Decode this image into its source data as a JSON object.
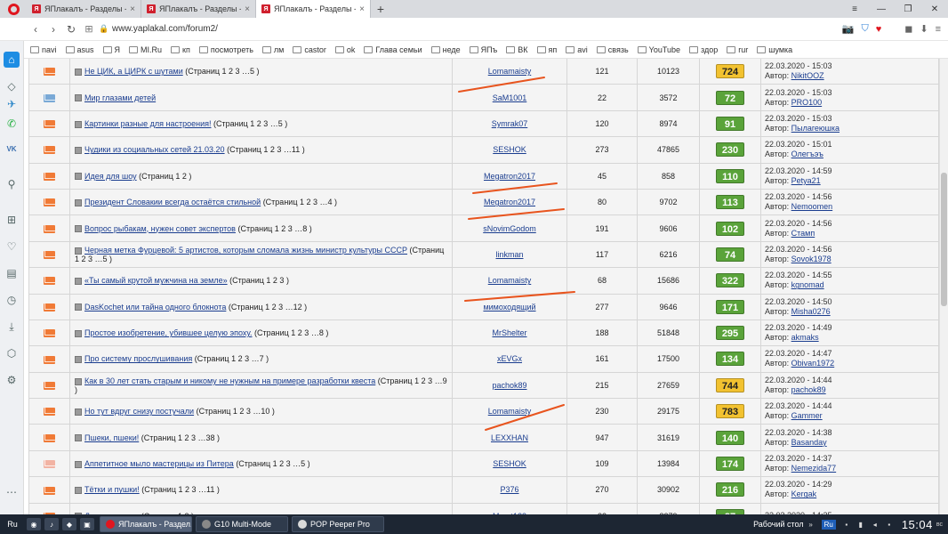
{
  "browser": {
    "tabs": [
      {
        "title": "ЯПлакалъ - Разделы -> Ка",
        "active": false
      },
      {
        "title": "ЯПлакалъ - Разделы -> Шу",
        "active": false
      },
      {
        "title": "ЯПлакалъ - Разделы -> Ка",
        "active": true
      }
    ],
    "new_tab": "+",
    "url": "www.yaplakal.com/forum2/"
  },
  "bookmarks": [
    "navi",
    "asus",
    "Я",
    "MI.Ru",
    "кп",
    "посмотреть",
    "лм",
    "castor",
    "ok",
    "Глава семьи",
    "неде",
    "ЯПъ",
    "ВК",
    "яп",
    "avi",
    "связь",
    "YouTube",
    "здор",
    "rur",
    "шумка"
  ],
  "topics": [
    {
      "icon": "orange",
      "title": "Не ЦИК, а ЦИРК с шутами",
      "pages": "(Страниц 1 2 3 …5 )",
      "author": "Lomamaisty",
      "replies": "121",
      "views": "10123",
      "rating": "724",
      "rating_color": "yellow",
      "last_date": "22.03.2020 - 15:03",
      "last_author": "NikitOOZ"
    },
    {
      "icon": "blue",
      "title": "Мир глазами детей",
      "pages": "",
      "author": "SaM1001",
      "replies": "22",
      "views": "3572",
      "rating": "72",
      "rating_color": "green",
      "last_date": "22.03.2020 - 15:03",
      "last_author": "PRO100"
    },
    {
      "icon": "orange",
      "title": "Картинки разные для настроения!",
      "pages": "(Страниц 1 2 3 …5 )",
      "author": "Symrak07",
      "replies": "120",
      "views": "8974",
      "rating": "91",
      "rating_color": "green",
      "last_date": "22.03.2020 - 15:03",
      "last_author": "Пылагеюшка"
    },
    {
      "icon": "orange",
      "title": "Чудики из социальных сетей 21.03.20",
      "pages": "(Страниц 1 2 3 …11 )",
      "author": "SESHOK",
      "replies": "273",
      "views": "47865",
      "rating": "230",
      "rating_color": "green",
      "last_date": "22.03.2020 - 15:01",
      "last_author": "Олегъэъ"
    },
    {
      "icon": "orange",
      "title": "Идея для шоу",
      "pages": "(Страниц 1 2 )",
      "author": "Megatron2017",
      "replies": "45",
      "views": "858",
      "rating": "110",
      "rating_color": "green",
      "last_date": "22.03.2020 - 14:59",
      "last_author": "Petya21"
    },
    {
      "icon": "orange",
      "title": "Президент Словакии всегда остаётся стильной",
      "pages": "(Страниц 1 2 3 …4 )",
      "author": "Megatron2017",
      "replies": "80",
      "views": "9702",
      "rating": "113",
      "rating_color": "green",
      "last_date": "22.03.2020 - 14:56",
      "last_author": "Nemoomen"
    },
    {
      "icon": "orange",
      "title": "Вопрос рыбакам, нужен совет экспертов",
      "pages": "(Страниц 1 2 3 …8 )",
      "author": "sNovimGodom",
      "replies": "191",
      "views": "9606",
      "rating": "102",
      "rating_color": "green",
      "last_date": "22.03.2020 - 14:56",
      "last_author": "Стамп"
    },
    {
      "icon": "orange",
      "title": "Черная метка Фурцевой: 5 артистов, которым сломала жизнь министр культуры СССР",
      "pages": "(Страниц 1 2 3 …5 )",
      "author": "linkman",
      "replies": "117",
      "views": "6216",
      "rating": "74",
      "rating_color": "green",
      "last_date": "22.03.2020 - 14:56",
      "last_author": "Sovok1978"
    },
    {
      "icon": "orange",
      "title": "«Ты самый крутой мужчина на земле»",
      "pages": "(Страниц 1 2 3 )",
      "author": "Lomamaisty",
      "replies": "68",
      "views": "15686",
      "rating": "322",
      "rating_color": "green",
      "last_date": "22.03.2020 - 14:55",
      "last_author": "kgnomad"
    },
    {
      "icon": "orange",
      "title": "DasKochet или тайна одного блокнота",
      "pages": "(Страниц 1 2 3 …12 )",
      "author": "мимоходящий",
      "replies": "277",
      "views": "9646",
      "rating": "171",
      "rating_color": "green",
      "last_date": "22.03.2020 - 14:50",
      "last_author": "Misha0276"
    },
    {
      "icon": "orange",
      "title": "Простое изобретение, убившее целую эпоху.",
      "pages": "(Страниц 1 2 3 …8 )",
      "author": "MrShelter",
      "replies": "188",
      "views": "51848",
      "rating": "295",
      "rating_color": "green",
      "last_date": "22.03.2020 - 14:49",
      "last_author": "akmaks"
    },
    {
      "icon": "orange",
      "title": "Про систему прослушивания",
      "pages": "(Страниц 1 2 3 …7 )",
      "author": "xEVGx",
      "replies": "161",
      "views": "17500",
      "rating": "134",
      "rating_color": "green",
      "last_date": "22.03.2020 - 14:47",
      "last_author": "Obivan1972"
    },
    {
      "icon": "orange",
      "title": "Как в 30 лет стать старым и никому не нужным на примере разработки квеста",
      "pages": "(Страниц 1 2 3 …9 )",
      "author": "pachok89",
      "replies": "215",
      "views": "27659",
      "rating": "744",
      "rating_color": "yellow",
      "last_date": "22.03.2020 - 14:44",
      "last_author": "pachok89"
    },
    {
      "icon": "orange",
      "title": "Но тут вдруг снизу постучали",
      "pages": "(Страниц 1 2 3 …10 )",
      "author": "Lomamaisty",
      "replies": "230",
      "views": "29175",
      "rating": "783",
      "rating_color": "yellow",
      "last_date": "22.03.2020 - 14:44",
      "last_author": "Gammer"
    },
    {
      "icon": "orange",
      "title": "Пшеки, пшеки!",
      "pages": "(Страниц 1 2 3 …38 )",
      "author": "LEXXHAN",
      "replies": "947",
      "views": "31619",
      "rating": "140",
      "rating_color": "green",
      "last_date": "22.03.2020 - 14:38",
      "last_author": "Basanday"
    },
    {
      "icon": "pink",
      "title": "Аппетитное мыло мастерицы из Питера",
      "pages": "(Страниц 1 2 3 …5 )",
      "author": "SESHOK",
      "replies": "109",
      "views": "13984",
      "rating": "174",
      "rating_color": "green",
      "last_date": "22.03.2020 - 14:37",
      "last_author": "Nemezida77"
    },
    {
      "icon": "orange",
      "title": "Тётки и пушки!",
      "pages": "(Страниц 1 2 3 …11 )",
      "author": "P376",
      "replies": "270",
      "views": "30902",
      "rating": "216",
      "rating_color": "green",
      "last_date": "22.03.2020 - 14:29",
      "last_author": "Kergak"
    },
    {
      "icon": "orange",
      "title": "Демотиваторы",
      "pages": "(Страниц 1 2 )",
      "author": "Marat123",
      "replies": "32",
      "views": "8279",
      "rating": "87",
      "rating_color": "green",
      "last_date": "22.03.2020 - 14:25",
      "last_author": ""
    }
  ],
  "labels": {
    "author_prefix": "Автор: "
  },
  "taskbar": {
    "lang": "Ru",
    "tasks": [
      {
        "label": "ЯПлакалъ - Раздел...",
        "active": true
      },
      {
        "label": "G10 Multi-Mode",
        "active": false
      },
      {
        "label": "POP Peeper Pro",
        "active": false
      }
    ],
    "desktop": "Рабочий стол",
    "tray_lang": "Ru",
    "clock": "15:04",
    "day": "вс"
  },
  "colors": {
    "accent": "#1e8de3",
    "rating_green": "#5aa33a",
    "rating_yellow": "#f2c230",
    "marker": "#e8541e"
  }
}
